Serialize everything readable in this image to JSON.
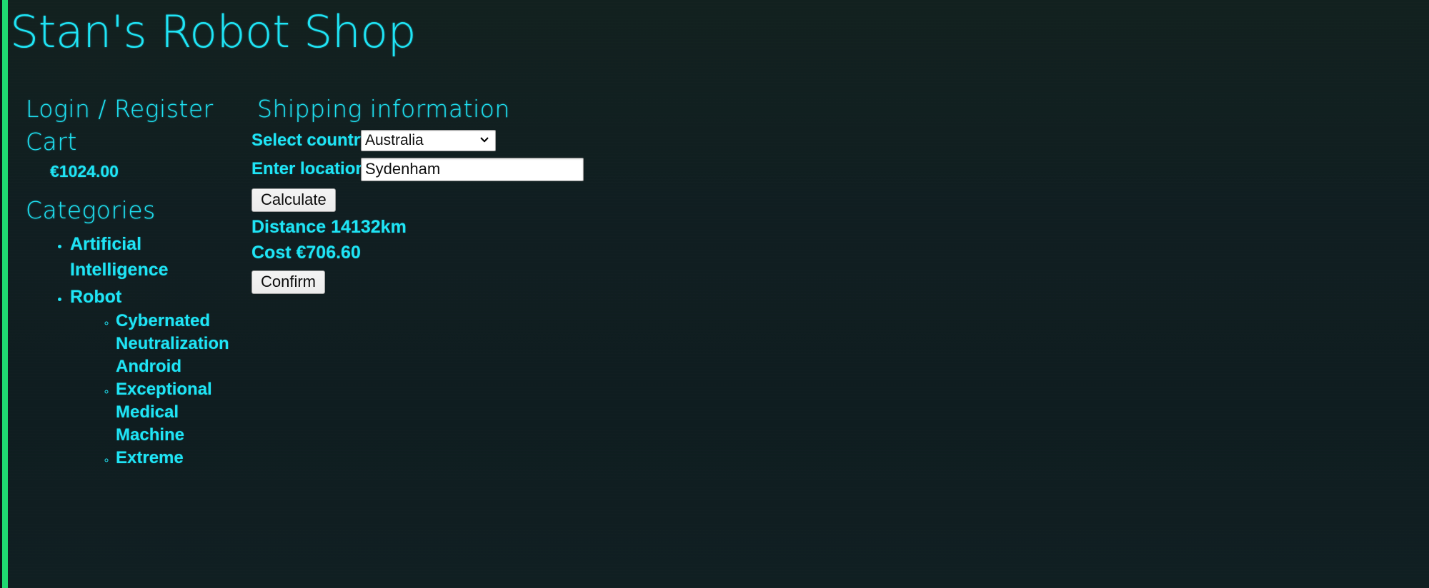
{
  "site": {
    "title": "Stan's Robot Shop"
  },
  "theme": {
    "background": "#101f22",
    "accent_rail": "#1fd971",
    "text_cyan": "#1fe4f5",
    "control_background": "#ffffff",
    "button_background": "#ececec"
  },
  "sidebar": {
    "login_register_label": "Login / Register",
    "cart_label": "Cart",
    "cart_total": "€1024.00",
    "categories_heading": "Categories",
    "categories": [
      {
        "label": "Artificial Intelligence",
        "children": []
      },
      {
        "label": "Robot",
        "children": [
          {
            "label": "Cybernated Neutralization Android"
          },
          {
            "label": "Exceptional Medical Machine"
          },
          {
            "label": "Extreme"
          }
        ]
      }
    ]
  },
  "shipping": {
    "heading": "Shipping information",
    "country_label": "Select country",
    "country_selected": "Australia",
    "country_options": [
      "Australia"
    ],
    "location_label": "Enter location",
    "location_value": "Sydenham",
    "location_placeholder": "",
    "calculate_label": "Calculate",
    "distance_text": "Distance 14132km",
    "cost_text": "Cost €706.60",
    "confirm_label": "Confirm"
  },
  "icons": {
    "chevron_down": "chevron-down-icon"
  }
}
